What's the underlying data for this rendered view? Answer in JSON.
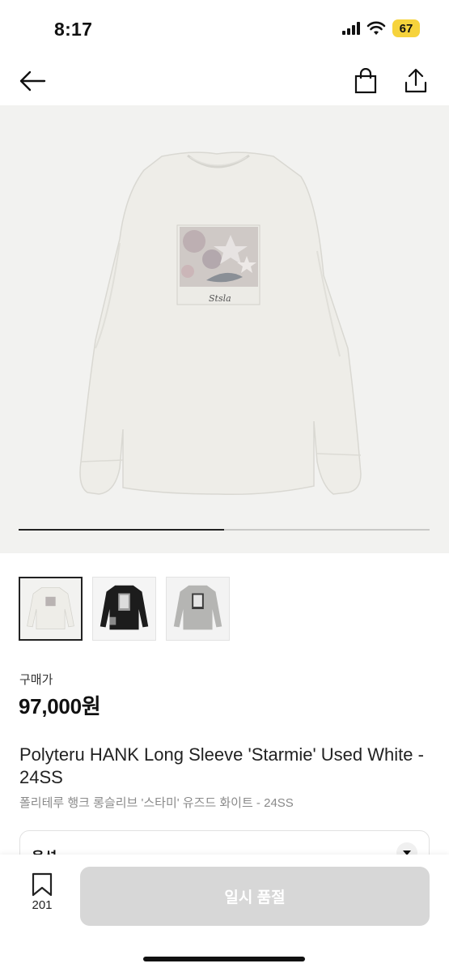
{
  "status_bar": {
    "time": "8:17",
    "battery": "67",
    "icons": [
      "signal-icon",
      "wifi-icon",
      "battery-icon"
    ]
  },
  "nav": {
    "icons": [
      "back-arrow-icon",
      "shopping-bag-icon",
      "share-icon"
    ]
  },
  "gallery": {
    "progress": 0.5,
    "thumbnails": [
      {
        "color": "white",
        "selected": true
      },
      {
        "color": "black",
        "selected": false
      },
      {
        "color": "grey",
        "selected": false
      }
    ],
    "print_text": "Stsla"
  },
  "product": {
    "price_label": "구매가",
    "price": "97,000원",
    "title_en": "Polyteru HANK Long Sleeve 'Starmie' Used White - 24SS",
    "title_ko": "폴리테루 행크 롱슬리브 '스타미' 유즈드 화이트 - 24SS"
  },
  "options": {
    "label": "옵션"
  },
  "bottom_bar": {
    "wish_count": "201",
    "buy_label": "일시 품절"
  },
  "colors": {
    "accent_battery": "#f6d33c",
    "disabled_button": "#d7d7d7",
    "image_background": "#f2f2f0"
  }
}
